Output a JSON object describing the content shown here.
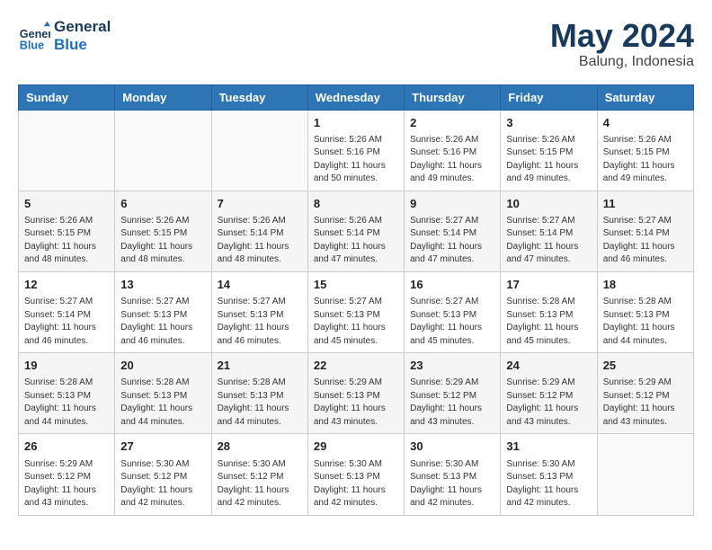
{
  "header": {
    "logo_line1": "General",
    "logo_line2": "Blue",
    "month_year": "May 2024",
    "location": "Balung, Indonesia"
  },
  "weekdays": [
    "Sunday",
    "Monday",
    "Tuesday",
    "Wednesday",
    "Thursday",
    "Friday",
    "Saturday"
  ],
  "weeks": [
    [
      {
        "day": "",
        "info": ""
      },
      {
        "day": "",
        "info": ""
      },
      {
        "day": "",
        "info": ""
      },
      {
        "day": "1",
        "info": "Sunrise: 5:26 AM\nSunset: 5:16 PM\nDaylight: 11 hours\nand 50 minutes."
      },
      {
        "day": "2",
        "info": "Sunrise: 5:26 AM\nSunset: 5:16 PM\nDaylight: 11 hours\nand 49 minutes."
      },
      {
        "day": "3",
        "info": "Sunrise: 5:26 AM\nSunset: 5:15 PM\nDaylight: 11 hours\nand 49 minutes."
      },
      {
        "day": "4",
        "info": "Sunrise: 5:26 AM\nSunset: 5:15 PM\nDaylight: 11 hours\nand 49 minutes."
      }
    ],
    [
      {
        "day": "5",
        "info": "Sunrise: 5:26 AM\nSunset: 5:15 PM\nDaylight: 11 hours\nand 48 minutes."
      },
      {
        "day": "6",
        "info": "Sunrise: 5:26 AM\nSunset: 5:15 PM\nDaylight: 11 hours\nand 48 minutes."
      },
      {
        "day": "7",
        "info": "Sunrise: 5:26 AM\nSunset: 5:14 PM\nDaylight: 11 hours\nand 48 minutes."
      },
      {
        "day": "8",
        "info": "Sunrise: 5:26 AM\nSunset: 5:14 PM\nDaylight: 11 hours\nand 47 minutes."
      },
      {
        "day": "9",
        "info": "Sunrise: 5:27 AM\nSunset: 5:14 PM\nDaylight: 11 hours\nand 47 minutes."
      },
      {
        "day": "10",
        "info": "Sunrise: 5:27 AM\nSunset: 5:14 PM\nDaylight: 11 hours\nand 47 minutes."
      },
      {
        "day": "11",
        "info": "Sunrise: 5:27 AM\nSunset: 5:14 PM\nDaylight: 11 hours\nand 46 minutes."
      }
    ],
    [
      {
        "day": "12",
        "info": "Sunrise: 5:27 AM\nSunset: 5:14 PM\nDaylight: 11 hours\nand 46 minutes."
      },
      {
        "day": "13",
        "info": "Sunrise: 5:27 AM\nSunset: 5:13 PM\nDaylight: 11 hours\nand 46 minutes."
      },
      {
        "day": "14",
        "info": "Sunrise: 5:27 AM\nSunset: 5:13 PM\nDaylight: 11 hours\nand 46 minutes."
      },
      {
        "day": "15",
        "info": "Sunrise: 5:27 AM\nSunset: 5:13 PM\nDaylight: 11 hours\nand 45 minutes."
      },
      {
        "day": "16",
        "info": "Sunrise: 5:27 AM\nSunset: 5:13 PM\nDaylight: 11 hours\nand 45 minutes."
      },
      {
        "day": "17",
        "info": "Sunrise: 5:28 AM\nSunset: 5:13 PM\nDaylight: 11 hours\nand 45 minutes."
      },
      {
        "day": "18",
        "info": "Sunrise: 5:28 AM\nSunset: 5:13 PM\nDaylight: 11 hours\nand 44 minutes."
      }
    ],
    [
      {
        "day": "19",
        "info": "Sunrise: 5:28 AM\nSunset: 5:13 PM\nDaylight: 11 hours\nand 44 minutes."
      },
      {
        "day": "20",
        "info": "Sunrise: 5:28 AM\nSunset: 5:13 PM\nDaylight: 11 hours\nand 44 minutes."
      },
      {
        "day": "21",
        "info": "Sunrise: 5:28 AM\nSunset: 5:13 PM\nDaylight: 11 hours\nand 44 minutes."
      },
      {
        "day": "22",
        "info": "Sunrise: 5:29 AM\nSunset: 5:13 PM\nDaylight: 11 hours\nand 43 minutes."
      },
      {
        "day": "23",
        "info": "Sunrise: 5:29 AM\nSunset: 5:12 PM\nDaylight: 11 hours\nand 43 minutes."
      },
      {
        "day": "24",
        "info": "Sunrise: 5:29 AM\nSunset: 5:12 PM\nDaylight: 11 hours\nand 43 minutes."
      },
      {
        "day": "25",
        "info": "Sunrise: 5:29 AM\nSunset: 5:12 PM\nDaylight: 11 hours\nand 43 minutes."
      }
    ],
    [
      {
        "day": "26",
        "info": "Sunrise: 5:29 AM\nSunset: 5:12 PM\nDaylight: 11 hours\nand 43 minutes."
      },
      {
        "day": "27",
        "info": "Sunrise: 5:30 AM\nSunset: 5:12 PM\nDaylight: 11 hours\nand 42 minutes."
      },
      {
        "day": "28",
        "info": "Sunrise: 5:30 AM\nSunset: 5:12 PM\nDaylight: 11 hours\nand 42 minutes."
      },
      {
        "day": "29",
        "info": "Sunrise: 5:30 AM\nSunset: 5:13 PM\nDaylight: 11 hours\nand 42 minutes."
      },
      {
        "day": "30",
        "info": "Sunrise: 5:30 AM\nSunset: 5:13 PM\nDaylight: 11 hours\nand 42 minutes."
      },
      {
        "day": "31",
        "info": "Sunrise: 5:30 AM\nSunset: 5:13 PM\nDaylight: 11 hours\nand 42 minutes."
      },
      {
        "day": "",
        "info": ""
      }
    ]
  ]
}
